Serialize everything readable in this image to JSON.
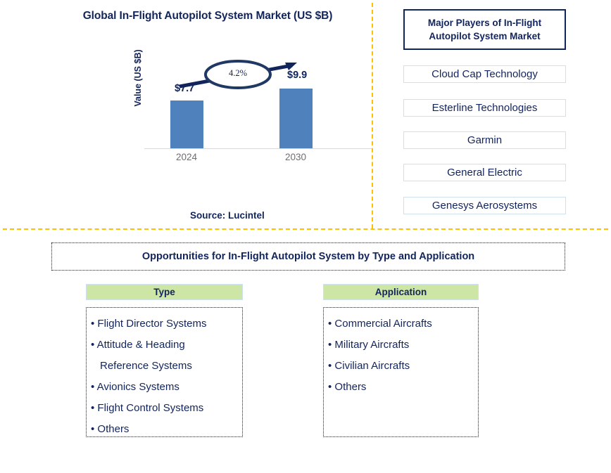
{
  "chart_data": {
    "type": "bar",
    "title": "Global In-Flight Autopilot System Market (US $B)",
    "ylabel": "Value (US $B)",
    "xlabel": "",
    "categories": [
      "2024",
      "2030"
    ],
    "values": [
      7.7,
      9.9
    ],
    "value_labels": [
      "$7.7",
      "$9.9"
    ],
    "cagr_label": "4.2%",
    "ylim": [
      0,
      11.5
    ],
    "grid": false,
    "legend": "none",
    "bar_color": "#4F81BD",
    "source": "Source: Lucintel"
  },
  "players_panel": {
    "header": "Major Players of In-Flight Autopilot System Market",
    "header_line1": "Major Players of In-Flight",
    "header_line2": "Autopilot System Market",
    "items": [
      {
        "name": "Cloud Cap Technology"
      },
      {
        "name": "Esterline Technologies"
      },
      {
        "name": "Garmin"
      },
      {
        "name": "General Electric"
      },
      {
        "name": "Genesys Aerosystems"
      }
    ]
  },
  "opportunities": {
    "banner": "Opportunities for In-Flight Autopilot System by Type and Application",
    "type_column": {
      "header": "Type",
      "items": [
        {
          "text": "• Flight Director Systems",
          "continuation": false
        },
        {
          "text": "• Attitude & Heading",
          "continuation": false
        },
        {
          "text": "Reference Systems",
          "continuation": true
        },
        {
          "text": "• Avionics Systems",
          "continuation": false
        },
        {
          "text": "• Flight Control Systems",
          "continuation": false
        },
        {
          "text": "• Others",
          "continuation": false
        }
      ]
    },
    "application_column": {
      "header": "Application",
      "items": [
        {
          "text": "• Commercial Aircrafts",
          "continuation": false
        },
        {
          "text": "• Military Aircrafts",
          "continuation": false
        },
        {
          "text": "• Civilian Aircrafts",
          "continuation": false
        },
        {
          "text": "• Others",
          "continuation": false
        }
      ]
    }
  },
  "colors": {
    "navy": "#12245C",
    "bar_blue": "#4F81BD",
    "divider_gold": "#FFC000",
    "header_green": "#CDE6A5",
    "box_border_light_blue": "#CFE0EF"
  }
}
